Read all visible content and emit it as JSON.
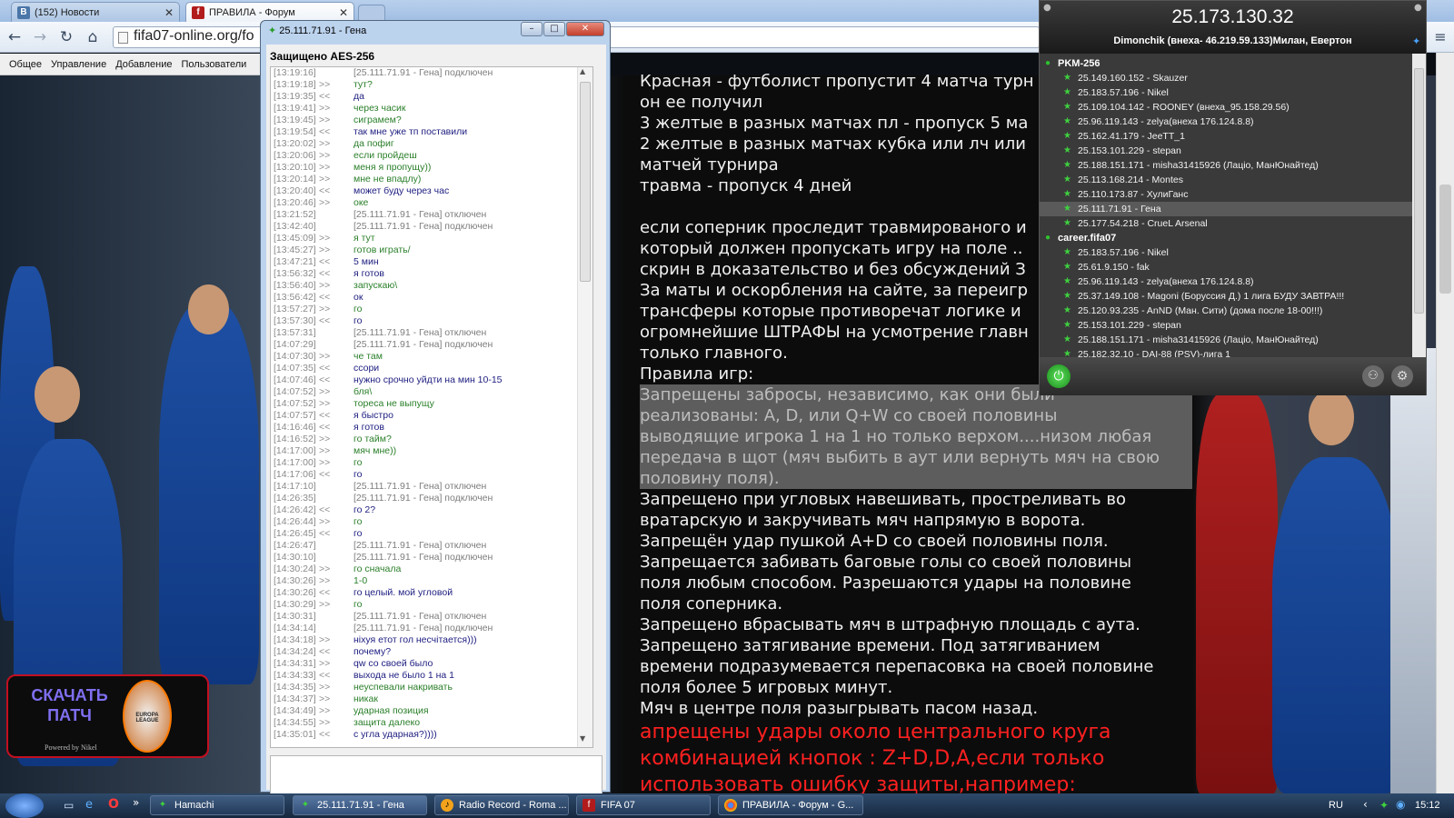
{
  "browser": {
    "tabs": [
      {
        "label": "(152) Новости",
        "icon": "vk-icon"
      },
      {
        "label": "ПРАВИЛА - Форум",
        "icon": "forum-icon"
      }
    ],
    "url": "fifa07-online.org/fo",
    "forum_menu": [
      "Общее",
      "Управление",
      "Добавление",
      "Пользователи"
    ]
  },
  "rules": {
    "lines": [
      "Красная - футболист пропустит 4 матча турн",
      "он ее получил",
      "3 желтые в разных матчах пл - пропуск 5 ма",
      "2 желтые в разных матчах кубка или лч или",
      "матчей турнира",
      "травма - пропуск 4 дней",
      "",
      "если соперник проследит травмированого и",
      "который должен пропускать игру на поле ..",
      "скрин в доказательство и без обсуждений З",
      "За маты и оскорбления на сайте, за переигр",
      "трансферы которые противоречат логике и",
      "огромнейшие ШТРАФЫ на усмотрение главн",
      "только главного.",
      "Правила игр:"
    ],
    "highlighted": [
      "Запрещены забросы, независимо, как они были",
      "реализованы: A, D, или Q+W со своей половины",
      "выводящие игрока 1 на 1 но только верхом....низом любая",
      "передача в щот (мяч выбить в аут или вернуть мяч на свою",
      "половину поля)."
    ],
    "after": [
      "Запрещено при угловых навешивать, прострeливать во",
      "вратарскую и закручивать мяч напрямую в ворота.",
      "Запрещён удар пушкой A+D со своей половины поля.",
      "Запрещается забивать баговые голы со своей половины",
      "поля любым способом. Разрешаются удары на половине",
      "поля соперника.",
      "Запрещено вбрасывать мяч в штрафную площадь с аута.",
      "Запрещено затягивание времени. Под затягиванием",
      "времени подразумевается перепасовка на своей половине",
      "поля более 5 игровых минут.",
      "Мяч в центре поля разыгрывать пасом назад."
    ],
    "red": [
      "апрещены удары около центрального круга",
      "комбинацией кнопок : Z+D,D,A,если только",
      "использовать ошибку защиты,например:"
    ]
  },
  "patch": {
    "line1": "СКАЧАТЬ",
    "line2": "ПАТЧ",
    "badge": "EUROPA LEAGUE",
    "credit": "Powered by Nikel"
  },
  "chat": {
    "title": "25.111.71.91 - Гена",
    "encryption": "Защищено AES-256",
    "log": [
      {
        "t": "[13:19:16]",
        "d": "",
        "m": "[25.111.71.91 - Гена] подключен",
        "k": "s"
      },
      {
        "t": "[13:19:18]",
        "d": ">>",
        "m": "тут?",
        "k": "g"
      },
      {
        "t": "[13:19:35]",
        "d": "<<",
        "m": "да",
        "k": "b"
      },
      {
        "t": "[13:19:41]",
        "d": ">>",
        "m": "через часик",
        "k": "g"
      },
      {
        "t": "[13:19:45]",
        "d": ">>",
        "m": "сиграмем?",
        "k": "g"
      },
      {
        "t": "[13:19:54]",
        "d": "<<",
        "m": "так мне уже тп поставили",
        "k": "b"
      },
      {
        "t": "[13:20:02]",
        "d": ">>",
        "m": "да пофиг",
        "k": "g"
      },
      {
        "t": "[13:20:06]",
        "d": ">>",
        "m": "если пройдеш",
        "k": "g"
      },
      {
        "t": "[13:20:10]",
        "d": ">>",
        "m": "меня я пропущу))",
        "k": "g"
      },
      {
        "t": "[13:20:14]",
        "d": ">>",
        "m": "мне не впадлу)",
        "k": "g"
      },
      {
        "t": "[13:20:40]",
        "d": "<<",
        "m": "может буду через час",
        "k": "b"
      },
      {
        "t": "[13:20:46]",
        "d": ">>",
        "m": "оке",
        "k": "g"
      },
      {
        "t": "[13:21:52]",
        "d": "",
        "m": "[25.111.71.91 - Гена] отключен",
        "k": "s"
      },
      {
        "t": "[13:42:40]",
        "d": "",
        "m": "[25.111.71.91 - Гена] подключен",
        "k": "s"
      },
      {
        "t": "[13:45:09]",
        "d": ">>",
        "m": "я тут",
        "k": "g"
      },
      {
        "t": "[13:45:27]",
        "d": ">>",
        "m": "готов играть/",
        "k": "g"
      },
      {
        "t": "[13:47:21]",
        "d": "<<",
        "m": "5 мин",
        "k": "b"
      },
      {
        "t": "[13:56:32]",
        "d": "<<",
        "m": "я готов",
        "k": "b"
      },
      {
        "t": "[13:56:40]",
        "d": ">>",
        "m": "запускаю\\",
        "k": "g"
      },
      {
        "t": "[13:56:42]",
        "d": "<<",
        "m": "ок",
        "k": "b"
      },
      {
        "t": "[13:57:27]",
        "d": ">>",
        "m": "го",
        "k": "g"
      },
      {
        "t": "[13:57:30]",
        "d": "<<",
        "m": "го",
        "k": "b"
      },
      {
        "t": "[13:57:31]",
        "d": "",
        "m": "[25.111.71.91 - Гена] отключен",
        "k": "s"
      },
      {
        "t": "[14:07:29]",
        "d": "",
        "m": "[25.111.71.91 - Гена] подключен",
        "k": "s"
      },
      {
        "t": "[14:07:30]",
        "d": ">>",
        "m": "че там",
        "k": "g"
      },
      {
        "t": "[14:07:35]",
        "d": "<<",
        "m": "ссори",
        "k": "b"
      },
      {
        "t": "[14:07:46]",
        "d": "<<",
        "m": "нужно срочно уйдти на мин 10-15",
        "k": "b"
      },
      {
        "t": "[14:07:52]",
        "d": ">>",
        "m": "бля\\",
        "k": "g"
      },
      {
        "t": "[14:07:52]",
        "d": ">>",
        "m": "тореса не выпущу",
        "k": "g"
      },
      {
        "t": "[14:07:57]",
        "d": "<<",
        "m": "я быстро",
        "k": "b"
      },
      {
        "t": "[14:16:46]",
        "d": "<<",
        "m": "я готов",
        "k": "b"
      },
      {
        "t": "[14:16:52]",
        "d": ">>",
        "m": "го тайм?",
        "k": "g"
      },
      {
        "t": "[14:17:00]",
        "d": ">>",
        "m": "мяч мне))",
        "k": "g"
      },
      {
        "t": "[14:17:00]",
        "d": ">>",
        "m": "го",
        "k": "g"
      },
      {
        "t": "[14:17:06]",
        "d": "<<",
        "m": "го",
        "k": "b"
      },
      {
        "t": "[14:17:10]",
        "d": "",
        "m": "[25.111.71.91 - Гена] отключен",
        "k": "s"
      },
      {
        "t": "[14:26:35]",
        "d": "",
        "m": "[25.111.71.91 - Гена] подключен",
        "k": "s"
      },
      {
        "t": "[14:26:42]",
        "d": "<<",
        "m": "го 2?",
        "k": "b"
      },
      {
        "t": "[14:26:44]",
        "d": ">>",
        "m": "го",
        "k": "g"
      },
      {
        "t": "[14:26:45]",
        "d": "<<",
        "m": "го",
        "k": "b"
      },
      {
        "t": "[14:26:47]",
        "d": "",
        "m": "[25.111.71.91 - Гена] отключен",
        "k": "s"
      },
      {
        "t": "[14:30:10]",
        "d": "",
        "m": "[25.111.71.91 - Гена] подключен",
        "k": "s"
      },
      {
        "t": "[14:30:24]",
        "d": ">>",
        "m": "го сначала",
        "k": "g"
      },
      {
        "t": "[14:30:26]",
        "d": ">>",
        "m": "1-0",
        "k": "g"
      },
      {
        "t": "[14:30:26]",
        "d": "<<",
        "m": "го целый. мой угловой",
        "k": "b"
      },
      {
        "t": "[14:30:29]",
        "d": ">>",
        "m": "го",
        "k": "g"
      },
      {
        "t": "[14:30:31]",
        "d": "",
        "m": "[25.111.71.91 - Гена] отключен",
        "k": "s"
      },
      {
        "t": "[14:34:14]",
        "d": "",
        "m": "[25.111.71.91 - Гена] подключен",
        "k": "s"
      },
      {
        "t": "[14:34:18]",
        "d": ">>",
        "m": "ніхуя етот гол несчітается)))",
        "k": "b"
      },
      {
        "t": "[14:34:24]",
        "d": "<<",
        "m": "почему?",
        "k": "b"
      },
      {
        "t": "[14:34:31]",
        "d": ">>",
        "m": "qw со своей было",
        "k": "b"
      },
      {
        "t": "[14:34:33]",
        "d": "<<",
        "m": "выхода не было 1 на 1",
        "k": "b"
      },
      {
        "t": "[14:34:35]",
        "d": ">>",
        "m": "неуспевали накривать",
        "k": "g"
      },
      {
        "t": "[14:34:37]",
        "d": ">>",
        "m": "никак",
        "k": "g"
      },
      {
        "t": "[14:34:49]",
        "d": ">>",
        "m": "ударная позиция",
        "k": "g"
      },
      {
        "t": "[14:34:55]",
        "d": ">>",
        "m": "защита далеко",
        "k": "g"
      },
      {
        "t": "[14:35:01]",
        "d": "<<",
        "m": "с угла ударная?))))",
        "k": "b"
      }
    ]
  },
  "hamachi": {
    "ip": "25.173.130.32",
    "nick": "Dimonchik (внеха- 46.219.59.133)Милан, Евертон",
    "networks": [
      {
        "name": "PKM-256",
        "peers": [
          "25.149.160.152 - Skauzer",
          "25.183.57.196 - Nikel",
          "25.109.104.142 - ROONEY (внеха_95.158.29.56)",
          "25.96.119.143 - zelya(внеха 176.124.8.8)",
          "25.162.41.179 - JeeTT_1",
          "25.153.101.229 - stepan",
          "25.188.151.171 - misha31415926 (Лаціо, МанЮнайтед)",
          "25.113.168.214 - Montes",
          "25.110.173.87 - ХулиГанс",
          "25.111.71.91 - Гена",
          "25.177.54.218 - CrueL Arsenal"
        ]
      },
      {
        "name": "career.fifa07",
        "peers": [
          "25.183.57.196 - Nikel",
          "25.61.9.150 - fak",
          "25.96.119.143 - zelya(внеха 176.124.8.8)",
          "25.37.149.108 - Magoni (Боруссия Д.) 1 лига БУДУ ЗАВТРА!!!",
          "25.120.93.235 - AnND (Ман. Сити) (дома после 18-00!!!)",
          "25.153.101.229 - stepan",
          "25.188.151.171 - misha31415926 (Лаціо, МанЮнайтед)",
          "25.182.32.10 - DAI-88 (PSV)-лига 1"
        ]
      }
    ]
  },
  "taskbar": {
    "items": [
      {
        "label": "Hamachi",
        "icon": "hamachi-icon"
      },
      {
        "label": "25.111.71.91 - Гена",
        "icon": "chat-icon"
      },
      {
        "label": "Radio Record - Roma ...",
        "icon": "radio-icon"
      },
      {
        "label": "FIFA 07",
        "icon": "fifa-icon"
      },
      {
        "label": "ПРАВИЛА - Форум - G...",
        "icon": "chrome-icon"
      }
    ],
    "lang": "RU",
    "clock": "15:12"
  },
  "colors": {
    "accent": "#2ec22e",
    "highlight_red": "#ff2020",
    "chat_green": "#2a7f2a",
    "chat_blue": "#1d1d80"
  }
}
